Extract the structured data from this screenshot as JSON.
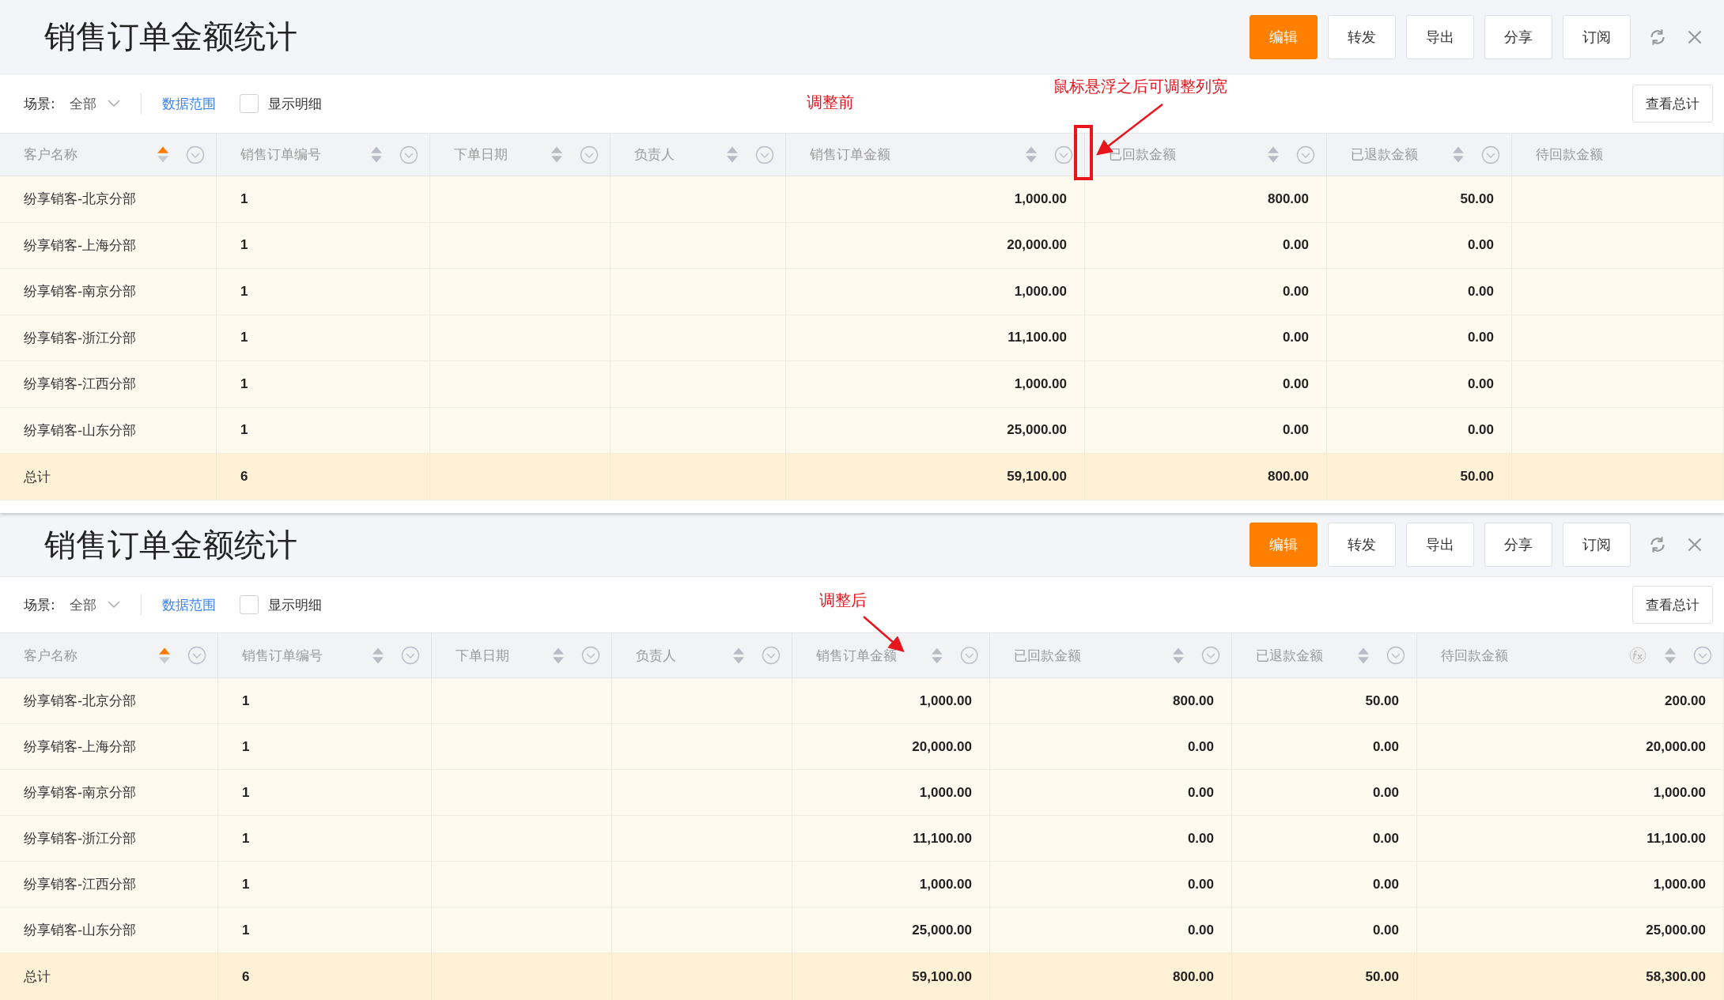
{
  "panels": [
    {
      "title": "销售订单金额统计",
      "buttons": [
        {
          "label": "编辑",
          "primary": true
        },
        {
          "label": "转发",
          "primary": false
        },
        {
          "label": "导出",
          "primary": false
        },
        {
          "label": "分享",
          "primary": false
        },
        {
          "label": "订阅",
          "primary": false
        }
      ],
      "scene_label": "场景:",
      "scene_value": "全部",
      "data_range_link": "数据范围",
      "show_detail": {
        "label": "显示明细",
        "checked": false
      },
      "view_total_button": "查看总计",
      "annotations": [
        {
          "kind": "label",
          "text": "调整前"
        },
        {
          "kind": "callout-box",
          "text": "鼠标悬浮之后可调整列宽"
        }
      ],
      "columns": [
        {
          "label": "客户名称",
          "sortable": true,
          "sorted": true,
          "filter": true,
          "formula": false
        },
        {
          "label": "销售订单编号",
          "sortable": true,
          "sorted": false,
          "filter": true,
          "formula": false
        },
        {
          "label": "下单日期",
          "sortable": true,
          "sorted": false,
          "filter": true,
          "formula": false
        },
        {
          "label": "负责人",
          "sortable": true,
          "sorted": false,
          "filter": true,
          "formula": false
        },
        {
          "label": "销售订单金额",
          "sortable": true,
          "sorted": false,
          "filter": true,
          "formula": false
        },
        {
          "label": "已回款金额",
          "sortable": true,
          "sorted": false,
          "filter": true,
          "formula": false
        },
        {
          "label": "已退款金额",
          "sortable": true,
          "sorted": false,
          "filter": true,
          "formula": false
        },
        {
          "label": "待回款金额",
          "sortable": false,
          "filter": false,
          "formula": false
        }
      ],
      "rows": [
        {
          "customer": "纷享销客-北京分部",
          "order_count": "1",
          "amount": "1,000.00",
          "received": "800.00",
          "refunded": "50.00"
        },
        {
          "customer": "纷享销客-上海分部",
          "order_count": "1",
          "amount": "20,000.00",
          "received": "0.00",
          "refunded": "0.00"
        },
        {
          "customer": "纷享销客-南京分部",
          "order_count": "1",
          "amount": "1,000.00",
          "received": "0.00",
          "refunded": "0.00"
        },
        {
          "customer": "纷享销客-浙江分部",
          "order_count": "1",
          "amount": "11,100.00",
          "received": "0.00",
          "refunded": "0.00"
        },
        {
          "customer": "纷享销客-江西分部",
          "order_count": "1",
          "amount": "1,000.00",
          "received": "0.00",
          "refunded": "0.00"
        },
        {
          "customer": "纷享销客-山东分部",
          "order_count": "1",
          "amount": "25,000.00",
          "received": "0.00",
          "refunded": "0.00"
        }
      ],
      "total": {
        "customer": "总计",
        "order_count": "6",
        "amount": "59,100.00",
        "received": "800.00",
        "refunded": "50.00"
      }
    },
    {
      "title": "销售订单金额统计",
      "buttons": [
        {
          "label": "编辑",
          "primary": true
        },
        {
          "label": "转发",
          "primary": false
        },
        {
          "label": "导出",
          "primary": false
        },
        {
          "label": "分享",
          "primary": false
        },
        {
          "label": "订阅",
          "primary": false
        }
      ],
      "scene_label": "场景:",
      "scene_value": "全部",
      "data_range_link": "数据范围",
      "show_detail": {
        "label": "显示明细",
        "checked": false
      },
      "view_total_button": "查看总计",
      "annotations": [
        {
          "kind": "callout",
          "text": "调整后"
        }
      ],
      "columns": [
        {
          "label": "客户名称",
          "sortable": true,
          "sorted": true,
          "filter": true,
          "formula": false
        },
        {
          "label": "销售订单编号",
          "sortable": true,
          "sorted": false,
          "filter": true,
          "formula": false
        },
        {
          "label": "下单日期",
          "sortable": true,
          "sorted": false,
          "filter": true,
          "formula": false
        },
        {
          "label": "负责人",
          "sortable": true,
          "sorted": false,
          "filter": true,
          "formula": false
        },
        {
          "label": "销售订单金额",
          "sortable": true,
          "sorted": false,
          "filter": true,
          "formula": false
        },
        {
          "label": "已回款金额",
          "sortable": true,
          "sorted": false,
          "filter": true,
          "formula": false
        },
        {
          "label": "已退款金额",
          "sortable": true,
          "sorted": false,
          "filter": true,
          "formula": false
        },
        {
          "label": "待回款金额",
          "sortable": true,
          "sorted": false,
          "filter": true,
          "formula": true
        }
      ],
      "rows": [
        {
          "customer": "纷享销客-北京分部",
          "order_count": "1",
          "amount": "1,000.00",
          "received": "800.00",
          "refunded": "50.00",
          "pending": "200.00"
        },
        {
          "customer": "纷享销客-上海分部",
          "order_count": "1",
          "amount": "20,000.00",
          "received": "0.00",
          "refunded": "0.00",
          "pending": "20,000.00"
        },
        {
          "customer": "纷享销客-南京分部",
          "order_count": "1",
          "amount": "1,000.00",
          "received": "0.00",
          "refunded": "0.00",
          "pending": "1,000.00"
        },
        {
          "customer": "纷享销客-浙江分部",
          "order_count": "1",
          "amount": "11,100.00",
          "received": "0.00",
          "refunded": "0.00",
          "pending": "11,100.00"
        },
        {
          "customer": "纷享销客-江西分部",
          "order_count": "1",
          "amount": "1,000.00",
          "received": "0.00",
          "refunded": "0.00",
          "pending": "1,000.00"
        },
        {
          "customer": "纷享销客-山东分部",
          "order_count": "1",
          "amount": "25,000.00",
          "received": "0.00",
          "refunded": "0.00",
          "pending": "25,000.00"
        }
      ],
      "total": {
        "customer": "总计",
        "order_count": "6",
        "amount": "59,100.00",
        "received": "800.00",
        "refunded": "50.00",
        "pending": "58,300.00"
      }
    }
  ]
}
